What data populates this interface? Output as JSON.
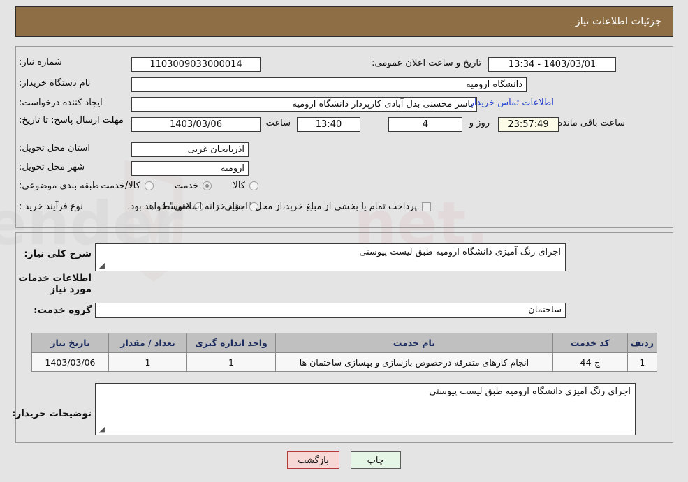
{
  "header": {
    "title": "جزئیات اطلاعات نیاز"
  },
  "top_form": {
    "need_number_label": "شماره نیاز:",
    "need_number_value": "1103009033000014",
    "announce_label": "تاریخ و ساعت اعلان عمومی:",
    "announce_value": "1403/03/01 - 13:34",
    "buyer_org_label": "نام دستگاه خریدار:",
    "buyer_org_value": "دانشگاه ارومیه",
    "creator_label": "ایجاد کننده درخواست:",
    "creator_value": "یاسر محسنی بدل آبادی کارپرداز دانشگاه ارومیه",
    "buyer_contact_link": "اطلاعات تماس خریدار",
    "deadline_label": "مهلت ارسال پاسخ: تا تاریخ:",
    "deadline_date": "1403/03/06",
    "hour_label": "ساعت",
    "deadline_time": "13:40",
    "days_value": "4",
    "days_unit": "روز و",
    "countdown_value": "23:57:49",
    "countdown_suffix": "ساعت باقی مانده",
    "province_label": "استان محل تحویل:",
    "province_value": "آذربایجان غربی",
    "city_label": "شهر محل تحویل:",
    "city_value": "ارومیه",
    "category_label": "طبقه بندی موضوعی:",
    "category_options": [
      {
        "label": "کالا",
        "checked": false
      },
      {
        "label": "خدمت",
        "checked": true
      },
      {
        "label": "کالا/خدمت",
        "checked": false
      }
    ],
    "process_label": "نوع فرآیند خرید :",
    "process_options": [
      {
        "label": "جزیی",
        "checked": false
      },
      {
        "label": "متوسط",
        "checked": false
      }
    ],
    "treasury_checkbox_text": "پرداخت تمام یا بخشی از مبلغ خرید،از محل \"اسناد خزانه اسلامی\" خواهد بود."
  },
  "middle": {
    "general_desc_label": "شرح کلی نیاز:",
    "general_desc_value": "اجرای رنگ آمیزی دانشگاه ارومیه طبق لیست پیوستی",
    "services_section_title": "اطلاعات خدمات مورد نیاز",
    "service_group_label": "گروه خدمت:",
    "service_group_value": "ساختمان",
    "buyer_notes_label": "توضیحات خریدار:",
    "buyer_notes_value": "اجرای رنگ آمیزی دانشگاه ارومیه طبق لیست پیوستی"
  },
  "table": {
    "headers": [
      "ردیف",
      "کد خدمت",
      "نام خدمت",
      "واحد اندازه گیری",
      "تعداد / مقدار",
      "تاریخ نیاز"
    ],
    "rows": [
      {
        "row": "1",
        "code": "ج-44",
        "name": "انجام کارهای متفرقه درخصوص بازسازی و بهسازی ساختمان ها",
        "unit": "1",
        "quantity": "1",
        "date": "1403/03/06"
      }
    ]
  },
  "footer": {
    "print_label": "چاپ",
    "back_label": "بازگشت"
  },
  "watermark": {
    "text": "AnaTender.net"
  },
  "colors": {
    "header_brown": "#8d6e45",
    "link_blue": "#2b43d0",
    "table_header_gray": "#c0c0c0",
    "page_bg": "#e4e4e4",
    "countdown_bg": "#fbfbe8",
    "back_button_bg": "#f8d7d7",
    "print_button_bg": "#e6f6e6"
  }
}
